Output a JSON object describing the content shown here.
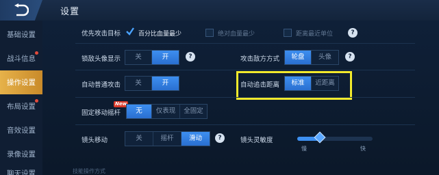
{
  "header": {
    "title": "设置"
  },
  "sidebar": {
    "items": [
      {
        "label": "基础设置"
      },
      {
        "label": "战斗信息"
      },
      {
        "label": "操作设置"
      },
      {
        "label": "布局设置"
      },
      {
        "label": "音效设置"
      },
      {
        "label": "录像设置"
      },
      {
        "label": "聊天设置"
      }
    ]
  },
  "settings": {
    "priority_target": {
      "label": "优先攻击目标",
      "options": [
        "百分比血量最少",
        "绝对血量最少",
        "距离最近单位"
      ],
      "checked": [
        true,
        false,
        false
      ]
    },
    "lock_avatar": {
      "label": "锁敌头像显示",
      "options": [
        "关",
        "开"
      ],
      "selected": "开"
    },
    "attack_mode": {
      "label": "攻击敌方方式",
      "options": [
        "轮盘",
        "头像"
      ],
      "selected": "轮盘"
    },
    "auto_attack": {
      "label": "自动普通攻击",
      "options": [
        "关",
        "开"
      ],
      "selected": "开"
    },
    "auto_chase": {
      "label": "自动追击距离",
      "options": [
        "标准",
        "近距离"
      ],
      "selected": "标准"
    },
    "fixed_joystick": {
      "label": "固定移动摇杆",
      "badge": "New",
      "options": [
        "无",
        "仅表现",
        "全固定"
      ],
      "selected": "无"
    },
    "camera_move": {
      "label": "镜头移动",
      "options": [
        "关",
        "摇杆",
        "滑动"
      ],
      "selected": "滑动"
    },
    "camera_sensitivity": {
      "label": "镜头灵敏度",
      "min_label": "慢",
      "max_label": "快",
      "level": 0.3
    }
  },
  "footer": {
    "section_label": "技能操作方式"
  },
  "colors": {
    "accent": "#3d8ff0",
    "active_tab": "#e6b24a",
    "highlight": "#f3ea2c"
  }
}
